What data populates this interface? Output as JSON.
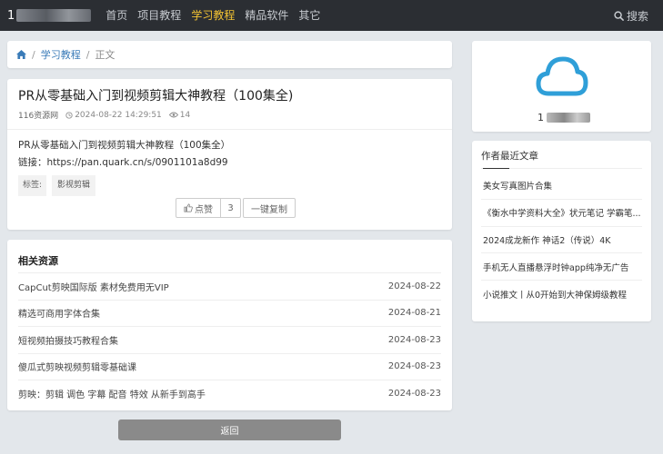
{
  "header": {
    "logo_text": "1",
    "nav": [
      "首页",
      "项目教程",
      "学习教程",
      "精品软件",
      "其它"
    ],
    "active_nav_index": 2,
    "search_label": "搜索"
  },
  "breadcrumb": {
    "category": "学习教程",
    "current": "正文",
    "sep": "/"
  },
  "article": {
    "title": "PR从零基础入门到视频剪辑大神教程（100集全)",
    "author": "116资源网",
    "datetime": "2024-08-22 14:29:51",
    "views": "14",
    "line1": "PR从零基础入门到视频剪辑大神教程（100集全）",
    "line2": "链接：https://pan.quark.cn/s/0901101a8d99",
    "tags_label": "标签:",
    "tag": "影视剪辑",
    "like_label": "点赞",
    "like_count": "3",
    "copy_label": "一键复制"
  },
  "related": {
    "title": "相关资源",
    "items": [
      {
        "title": "CapCut剪映国际版 素材免费用无VIP",
        "date": "2024-08-22"
      },
      {
        "title": "精选可商用字体合集",
        "date": "2024-08-21"
      },
      {
        "title": "短视频拍摄技巧教程合集",
        "date": "2024-08-23"
      },
      {
        "title": "傻瓜式剪映视频剪辑零基础课",
        "date": "2024-08-23"
      },
      {
        "title": "剪映：剪辑 调色 字幕 配音 特效 从新手到高手",
        "date": "2024-08-23"
      }
    ]
  },
  "back_label": "返回",
  "profile": {
    "name_prefix": "1",
    "icon": "cloud-icon",
    "accent": "#2f9fd8"
  },
  "recent": {
    "title": "作者最近文章",
    "items": [
      "美女写真图片合集",
      "《衡水中学资料大全》状元笔记 学霸笔...",
      "2024成龙新作 神话2（传说）4K",
      "手机无人直播悬浮时钟app纯净无广告",
      "小说推文丨从0开始到大神保姆级教程"
    ]
  }
}
